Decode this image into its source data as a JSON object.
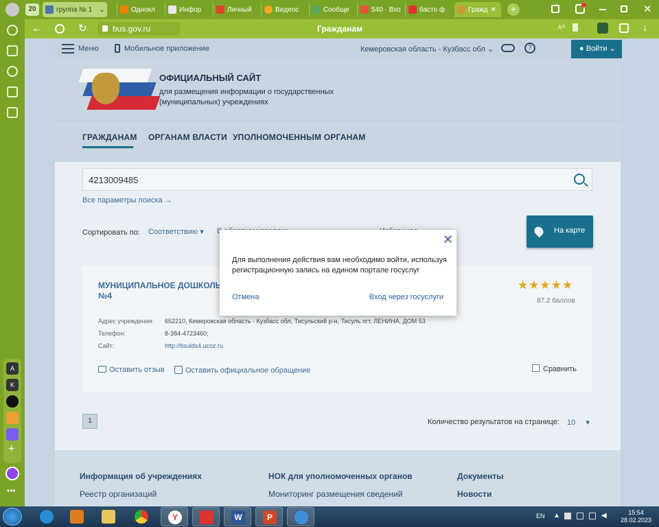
{
  "browser": {
    "tab_count": "20",
    "tabs": [
      {
        "label": "группа № 1"
      },
      {
        "label": "Однокл"
      },
      {
        "label": "Инфор"
      },
      {
        "label": "Личный"
      },
      {
        "label": "Видеос"
      },
      {
        "label": "Сообще"
      },
      {
        "label": "540 · Вхо"
      },
      {
        "label": "басто ф"
      },
      {
        "label": "Гражд"
      }
    ],
    "url": "bus.gov.ru",
    "page_title": "Гражданам"
  },
  "sidebar_badges": {
    "a": "A",
    "k": "K"
  },
  "site": {
    "menu_label": "Меню",
    "mobile_app_label": "Мобильное приложение",
    "region": "Кемеровская область - Кузбасс обл",
    "login_label": "Войти",
    "title": "ОФИЦИАЛЬНЫЙ САЙТ",
    "subtitle_line1": "для размещения информации о государственных",
    "subtitle_line2": "(муниципальных) учреждениях",
    "tabs": [
      {
        "label": "ГРАЖДАНАМ"
      },
      {
        "label": "ОРГАНАМ ВЛАСТИ"
      },
      {
        "label": "УПОЛНОМОЧЕННЫМ ОРГАНАМ"
      }
    ]
  },
  "search": {
    "value": "4213009485",
    "all_params": "Все параметры поиска →"
  },
  "sort": {
    "label": "Сортировать по:",
    "value": "Соответствию",
    "extra": "В обратном порядке",
    "extra2": "Избранное"
  },
  "map_button": "На карте",
  "result": {
    "name_line1": "МУНИЦИПАЛЬНОЕ ДОШКОЛЬНОЕ ОБРАЗОВАТЕЛЬНОЕ УЧРЕЖДЕНИЕ ДЕТСКИЙ САД",
    "name_line2": "№4",
    "rating_stars": 5,
    "score": "87.2 баллов",
    "address_label": "Адрес учреждения:",
    "address": "652210, Кемеровская область - Кузбасс обл, Тисульский р-н, Тисуль пгт, ЛЕНИНА, ДОМ 53",
    "phone_label": "Телефон:",
    "phone": "8-384-4723460;",
    "site_label": "Сайт:",
    "site": "http://tisulds4.ucoz.ru",
    "review_link": "Оставить отзыв",
    "appeal_link": "Оставить официальное обращение",
    "compare_label": "Сравнить"
  },
  "pagination": {
    "current_page": "1",
    "per_page_label": "Количество результатов на странице:",
    "per_page_value": "10"
  },
  "footer": {
    "col1_title": "Информация об учреждениях",
    "col1_item": "Реестр организаций",
    "col2_title": "НОК для уполномоченных органов",
    "col2_item": "Мониторинг размещения сведений",
    "col3_title": "Документы",
    "col3_item": "Новости"
  },
  "modal": {
    "message": "Для выполнения действия вам необходимо войти, используя регистрационную запись на едином портале госуслуг",
    "cancel": "Отмена",
    "login_gosuslugi": "Вход через госуслуги"
  },
  "taskbar": {
    "lang": "EN",
    "time": "15:54",
    "date": "28.02.2023"
  },
  "colors": {
    "browser_green": "#7ba427",
    "site_accent": "#1a6f8c",
    "star": "#e0a81c",
    "link": "#3c6a94"
  }
}
